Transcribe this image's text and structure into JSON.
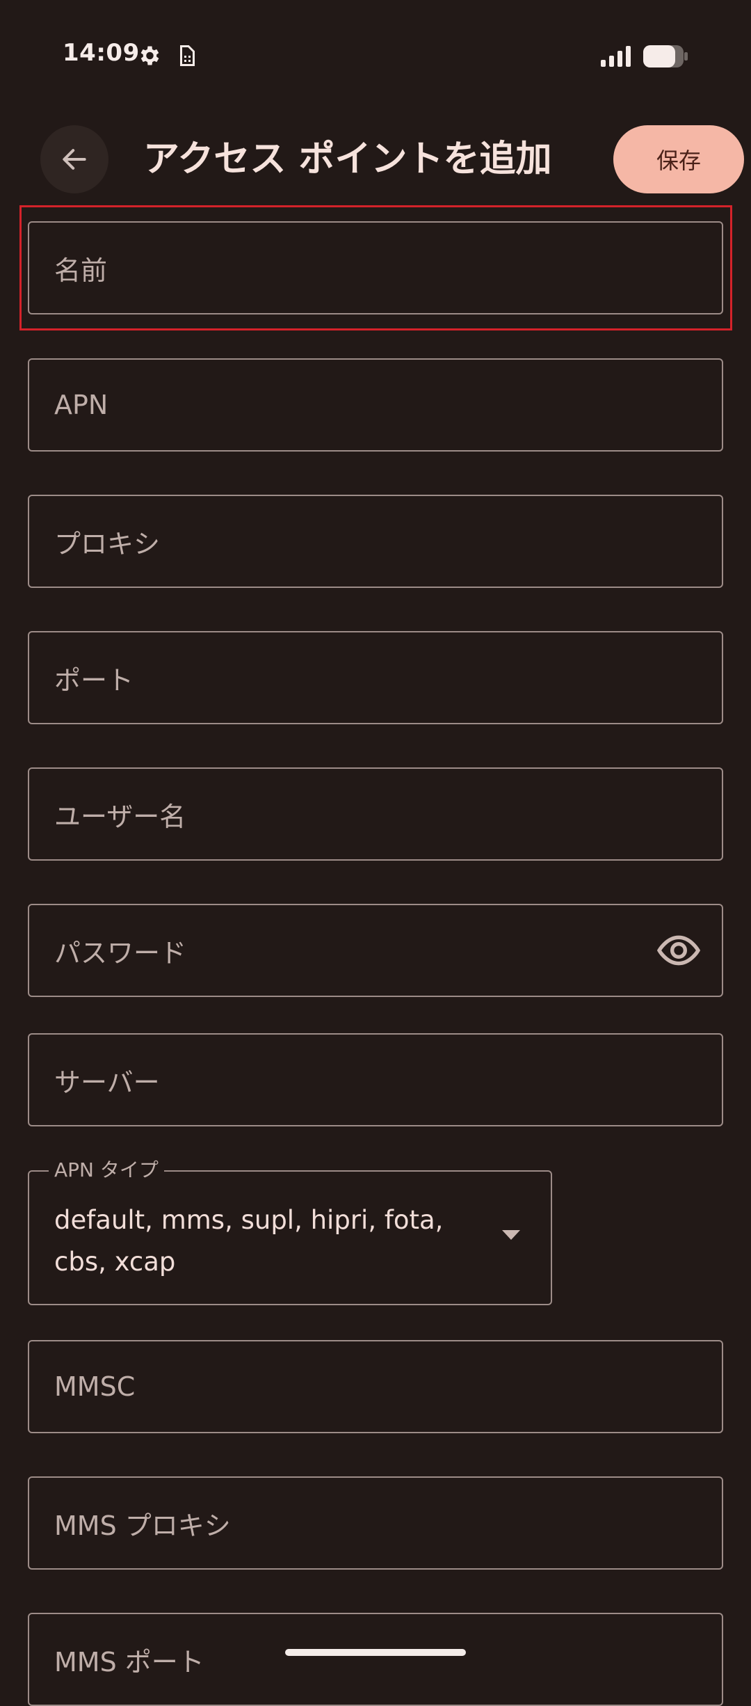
{
  "status_bar": {
    "time": "14:09",
    "icons": [
      "gear-icon",
      "sim-card-icon",
      "signal-icon",
      "battery-icon"
    ]
  },
  "app_bar": {
    "back_icon": "arrow-back-icon",
    "title": "アクセス ポイントを追加",
    "save_label": "保存"
  },
  "fields": {
    "name": "名前",
    "apn": "APN",
    "proxy": "プロキシ",
    "port": "ポート",
    "username": "ユーザー名",
    "password": "パスワード",
    "server": "サーバー",
    "mmsc": "MMSC",
    "mms_proxy": "MMS プロキシ",
    "mms_port": "MMS ポート"
  },
  "apn_type": {
    "label": "APN タイプ",
    "value": "default, mms, supl, hipri, fota, cbs, xcap"
  },
  "colors": {
    "background": "#221917",
    "accent": "#f5b7a6",
    "highlight": "#d4222a"
  }
}
